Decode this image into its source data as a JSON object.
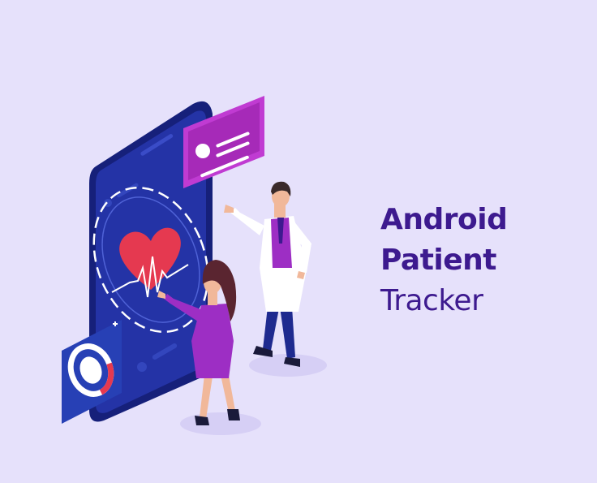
{
  "title": {
    "line1": "Android",
    "line2": "Patient",
    "line3": "Tracker"
  },
  "colors": {
    "background": "#e6e1fb",
    "title": "#3d1a8f",
    "phone": "#1e2a8f",
    "accent_magenta": "#b12bc4",
    "heart": "#e53950"
  },
  "icons": [
    "phone-illustration",
    "heart-icon",
    "profile-card-icon",
    "scan-card-icon",
    "doctor-figure",
    "woman-figure"
  ]
}
